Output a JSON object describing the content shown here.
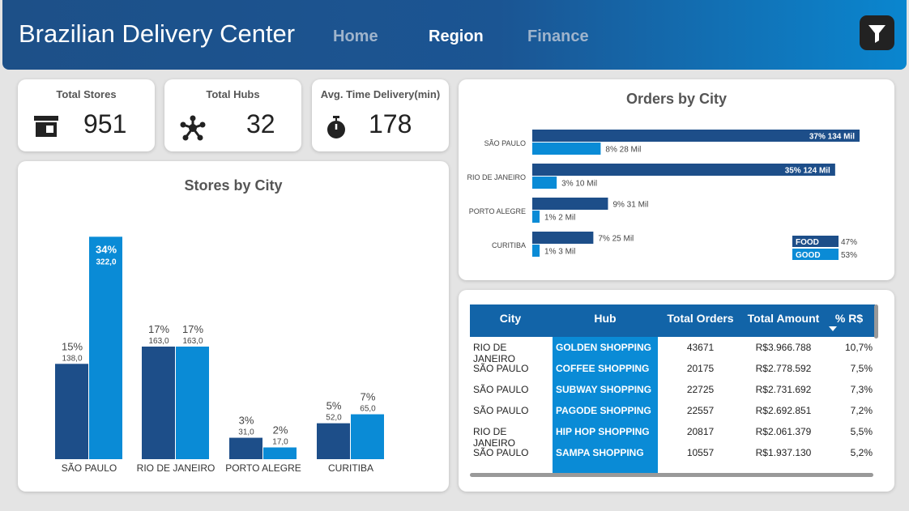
{
  "app": {
    "title": "Brazilian Delivery Center"
  },
  "nav": {
    "items": [
      {
        "label": "Home",
        "color": "#9fb4cc"
      },
      {
        "label": "Region",
        "color": "#ffffff"
      },
      {
        "label": "Finance",
        "color": "#9fb4cc"
      }
    ]
  },
  "kpis": [
    {
      "title": "Total Stores",
      "value": "951",
      "icon": "store-icon"
    },
    {
      "title": "Total Hubs",
      "value": "32",
      "icon": "hub-network-icon"
    },
    {
      "title": "Avg. Time Delivery(min)",
      "value": "178",
      "icon": "stopwatch-icon"
    }
  ],
  "colors": {
    "dark": "#1d4e89",
    "light": "#0a8bd6",
    "accent_text": "#ffffff"
  },
  "chart_data": [
    {
      "type": "bar",
      "title": "Stores by City",
      "categories": [
        "SÃO PAULO",
        "RIO DE JANEIRO",
        "PORTO ALEGRE",
        "CURITIBA"
      ],
      "series": [
        {
          "values": [
            138,
            163,
            31,
            52
          ],
          "pct_labels": [
            "15%",
            "17%",
            "3%",
            "5%"
          ],
          "value_labels": [
            "138,0",
            "163,0",
            "31,0",
            "52,0"
          ]
        },
        {
          "values": [
            322,
            163,
            17,
            65
          ],
          "pct_labels": [
            "34%",
            "17%",
            "2%",
            "7%"
          ],
          "value_labels": [
            "322,0",
            "163,0",
            "17,0",
            "65,0"
          ]
        }
      ],
      "ylim": [
        0,
        340
      ]
    },
    {
      "type": "bar",
      "orientation": "horizontal",
      "title": "Orders by City",
      "categories": [
        "SÃO PAULO",
        "RIO DE JANEIRO",
        "PORTO ALEGRE",
        "CURITIBA"
      ],
      "series": [
        {
          "name": "FOOD",
          "values": [
            134,
            124,
            31,
            25
          ],
          "labels": [
            "37% 134 Mil",
            "35% 124 Mil",
            "9% 31 Mil",
            "7% 25 Mil"
          ]
        },
        {
          "name": "GOOD",
          "values": [
            28,
            10,
            2,
            3
          ],
          "labels": [
            "8% 28 Mil",
            "3% 10 Mil",
            "1% 2 Mil",
            "1% 3 Mil"
          ]
        }
      ],
      "xlim": [
        0,
        134
      ],
      "legend": {
        "position": "bottom-right",
        "items": [
          {
            "name": "FOOD",
            "pct": "47%"
          },
          {
            "name": "GOOD",
            "pct": "53%"
          }
        ]
      }
    }
  ],
  "table": {
    "columns": [
      "City",
      "Hub",
      "Total Orders",
      "Total Amount",
      "% R$"
    ],
    "rows": [
      [
        "RIO DE JANEIRO",
        "GOLDEN SHOPPING",
        "43671",
        "R$3.966.788",
        "10,7%"
      ],
      [
        "SÃO PAULO",
        "COFFEE SHOPPING",
        "20175",
        "R$2.778.592",
        "7,5%"
      ],
      [
        "SÃO PAULO",
        "SUBWAY SHOPPING",
        "22725",
        "R$2.731.692",
        "7,3%"
      ],
      [
        "SÃO PAULO",
        "PAGODE SHOPPING",
        "22557",
        "R$2.692.851",
        "7,2%"
      ],
      [
        "RIO DE JANEIRO",
        "HIP HOP SHOPPING",
        "20817",
        "R$2.061.379",
        "5,5%"
      ],
      [
        "SÃO PAULO",
        "SAMPA SHOPPING",
        "10557",
        "R$1.937.130",
        "5,2%"
      ]
    ]
  }
}
